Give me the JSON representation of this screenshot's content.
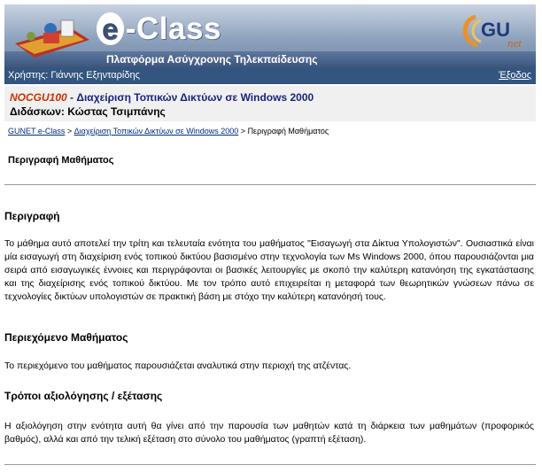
{
  "header": {
    "brand": "-Class",
    "brand_letter": "e",
    "tagline": "Πλατφόρμα Ασύγχρονης Τηλεκπαίδευσης",
    "gunet_logo": "GU",
    "gunet_logo_sub": "net"
  },
  "userbar": {
    "user": "Χρήστης: Γιάννης Εξηνταρίδης",
    "logout": "Έξοδος"
  },
  "course": {
    "code": "NOCGU100",
    "title": " - Διαχείριση Τοπικών Δικτύων σε Windows 2000",
    "professor": "Διδάσκων: Κώστας Τσιμπάνης"
  },
  "breadcrumb": {
    "home": "GUNET e-Class",
    "course": "Διαχείριση Τοπικών Δικτύων σε Windows 2000",
    "sep": ">",
    "current": "Περιγραφή Μαθήματος"
  },
  "page_title": "Περιγραφή Μαθήματος",
  "sections": [
    {
      "heading": "Περιγραφή",
      "text": "Το μάθημα αυτό αποτελεί την τρίτη και τελευταία ενότητα του μαθήματος \"Εισαγωγή στα Δίκτυα Υπολογιστών\". Ουσιαστικά είναι μία εισαγωγή στη διαχείριση ενός τοπικού δικτύου βασισμένο στην τεχνολογία των Ms Windows 2000, όπου παρουσιάζονται μια σειρά από εισαγωγικές έννοιες και περιγράφονται οι βασικές λειτουργίες με σκοπό την καλύτερη κατανόηση της εγκατάστασης και της διαχείρισης ενός τοπικού δικτύου. Με τον τρόπο αυτό επιχειρείται η μεταφορά των θεωρητικών γνώσεων πάνω σε τεχνολογίες δικτύων υπολογιστών σε πρακτική βάση με στόχο την καλύτερη κατανόησή τους."
    },
    {
      "heading": "Περιεχόμενο Μαθήματος",
      "text": "Το περιεχόμενο του μαθήματος παρουσιάζεται αναλυτικά στην περιοχή της ατζέντας."
    },
    {
      "heading": "Τρόποι αξιολόγησης / εξέτασης",
      "text": "Η αξιολόγηση στην ενότητα αυτή θα γίνει από την παρουσία των μαθητών κατά τη διάρκεια των μαθημάτων (προφορικός βαθμός), αλλά και από την τελική εξέταση στο σύνολο του μαθήματος (γραπτή εξέταση)."
    }
  ]
}
